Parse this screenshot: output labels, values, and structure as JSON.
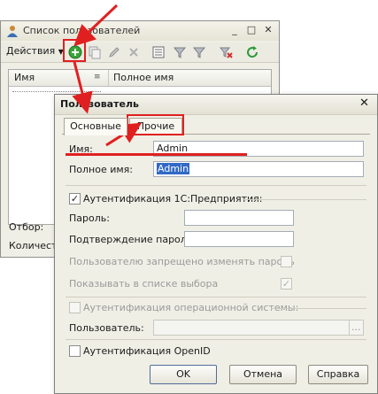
{
  "list_window": {
    "title": "Список пользователей",
    "toolbar": {
      "actions_label": "Действия",
      "icons": [
        "add-icon",
        "copy-icon",
        "edit-icon",
        "delete-icon",
        "hierarchy-icon",
        "filter-icon",
        "filter-dropdown-icon",
        "clear-filter-icon",
        "refresh-icon"
      ]
    },
    "columns": [
      "Имя",
      "Полное имя"
    ],
    "filter_label": "Отбор:",
    "count_label": "Количест"
  },
  "dialog": {
    "title": "Пользователь",
    "tabs": [
      {
        "label": "Основные",
        "active": true
      },
      {
        "label": "Прочие",
        "active": false
      }
    ],
    "fields": {
      "name_label": "Имя:",
      "name_value": "Admin",
      "full_name_label": "Полное имя:",
      "full_name_value": "Admin"
    },
    "auth_1c": {
      "label": "Аутентификация 1С:Предприятия:",
      "checked": true,
      "password_label": "Пароль:",
      "confirm_label": "Подтверждение пароля:",
      "cannot_change_label": "Пользователю запрещено изменять пароль",
      "cannot_change_checked": false,
      "show_in_list_label": "Показывать в списке выбора",
      "show_in_list_checked": true
    },
    "auth_os": {
      "label": "Аутентификация операционной системы:",
      "checked": false,
      "user_label": "Пользователь:",
      "browse_label": "..."
    },
    "auth_openid": {
      "label": "Аутентификация OpenID",
      "checked": false
    },
    "buttons": {
      "ok": "OK",
      "cancel": "Отмена",
      "help": "Справка"
    }
  },
  "annotation_color": "#e02020"
}
